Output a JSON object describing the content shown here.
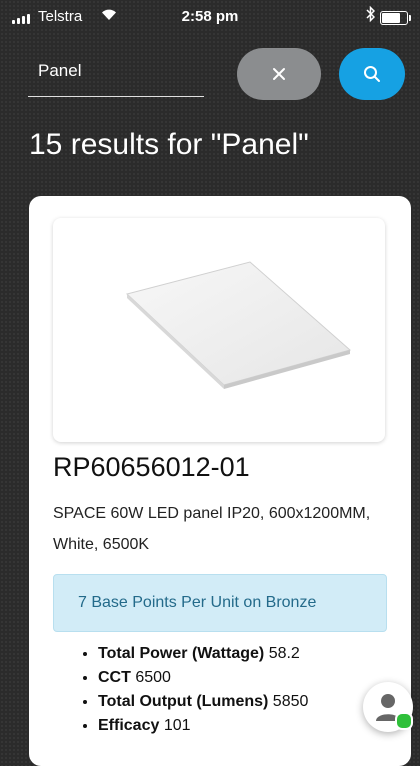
{
  "status_bar": {
    "carrier": "Telstra",
    "time": "2:58 pm",
    "battery_level": 0.7
  },
  "search": {
    "value": "Panel",
    "clear_icon": "close-icon",
    "search_icon": "search-icon"
  },
  "results": {
    "title": "15 results for \"Panel\""
  },
  "product": {
    "sku": "RP60656012-01",
    "description": "SPACE 60W LED panel IP20, 600x1200MM, White, 6500K",
    "points_label": "7 Base Points Per Unit on Bronze",
    "specs": [
      {
        "label": "Total Power (Wattage)",
        "value": "58.2"
      },
      {
        "label": "CCT",
        "value": "6500"
      },
      {
        "label": "Total Output (Lumens)",
        "value": "5850"
      },
      {
        "label": "Efficacy",
        "value": "101"
      }
    ]
  },
  "colors": {
    "accent": "#16a1e3",
    "clear_button": "#8b8d8f",
    "points_bg": "#d2ecf7",
    "online": "#2fc03a"
  }
}
